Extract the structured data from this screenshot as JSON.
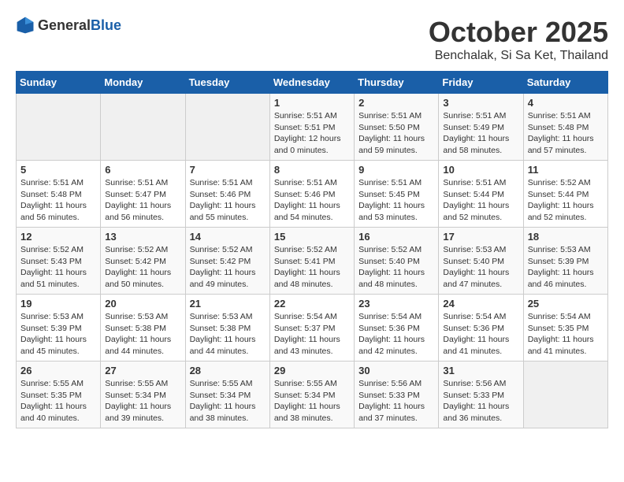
{
  "header": {
    "logo_general": "General",
    "logo_blue": "Blue",
    "month": "October 2025",
    "location": "Benchalak, Si Sa Ket, Thailand"
  },
  "days_of_week": [
    "Sunday",
    "Monday",
    "Tuesday",
    "Wednesday",
    "Thursday",
    "Friday",
    "Saturday"
  ],
  "weeks": [
    [
      {
        "day": "",
        "info": ""
      },
      {
        "day": "",
        "info": ""
      },
      {
        "day": "",
        "info": ""
      },
      {
        "day": "1",
        "info": "Sunrise: 5:51 AM\nSunset: 5:51 PM\nDaylight: 12 hours\nand 0 minutes."
      },
      {
        "day": "2",
        "info": "Sunrise: 5:51 AM\nSunset: 5:50 PM\nDaylight: 11 hours\nand 59 minutes."
      },
      {
        "day": "3",
        "info": "Sunrise: 5:51 AM\nSunset: 5:49 PM\nDaylight: 11 hours\nand 58 minutes."
      },
      {
        "day": "4",
        "info": "Sunrise: 5:51 AM\nSunset: 5:48 PM\nDaylight: 11 hours\nand 57 minutes."
      }
    ],
    [
      {
        "day": "5",
        "info": "Sunrise: 5:51 AM\nSunset: 5:48 PM\nDaylight: 11 hours\nand 56 minutes."
      },
      {
        "day": "6",
        "info": "Sunrise: 5:51 AM\nSunset: 5:47 PM\nDaylight: 11 hours\nand 56 minutes."
      },
      {
        "day": "7",
        "info": "Sunrise: 5:51 AM\nSunset: 5:46 PM\nDaylight: 11 hours\nand 55 minutes."
      },
      {
        "day": "8",
        "info": "Sunrise: 5:51 AM\nSunset: 5:46 PM\nDaylight: 11 hours\nand 54 minutes."
      },
      {
        "day": "9",
        "info": "Sunrise: 5:51 AM\nSunset: 5:45 PM\nDaylight: 11 hours\nand 53 minutes."
      },
      {
        "day": "10",
        "info": "Sunrise: 5:51 AM\nSunset: 5:44 PM\nDaylight: 11 hours\nand 52 minutes."
      },
      {
        "day": "11",
        "info": "Sunrise: 5:52 AM\nSunset: 5:44 PM\nDaylight: 11 hours\nand 52 minutes."
      }
    ],
    [
      {
        "day": "12",
        "info": "Sunrise: 5:52 AM\nSunset: 5:43 PM\nDaylight: 11 hours\nand 51 minutes."
      },
      {
        "day": "13",
        "info": "Sunrise: 5:52 AM\nSunset: 5:42 PM\nDaylight: 11 hours\nand 50 minutes."
      },
      {
        "day": "14",
        "info": "Sunrise: 5:52 AM\nSunset: 5:42 PM\nDaylight: 11 hours\nand 49 minutes."
      },
      {
        "day": "15",
        "info": "Sunrise: 5:52 AM\nSunset: 5:41 PM\nDaylight: 11 hours\nand 48 minutes."
      },
      {
        "day": "16",
        "info": "Sunrise: 5:52 AM\nSunset: 5:40 PM\nDaylight: 11 hours\nand 48 minutes."
      },
      {
        "day": "17",
        "info": "Sunrise: 5:53 AM\nSunset: 5:40 PM\nDaylight: 11 hours\nand 47 minutes."
      },
      {
        "day": "18",
        "info": "Sunrise: 5:53 AM\nSunset: 5:39 PM\nDaylight: 11 hours\nand 46 minutes."
      }
    ],
    [
      {
        "day": "19",
        "info": "Sunrise: 5:53 AM\nSunset: 5:39 PM\nDaylight: 11 hours\nand 45 minutes."
      },
      {
        "day": "20",
        "info": "Sunrise: 5:53 AM\nSunset: 5:38 PM\nDaylight: 11 hours\nand 44 minutes."
      },
      {
        "day": "21",
        "info": "Sunrise: 5:53 AM\nSunset: 5:38 PM\nDaylight: 11 hours\nand 44 minutes."
      },
      {
        "day": "22",
        "info": "Sunrise: 5:54 AM\nSunset: 5:37 PM\nDaylight: 11 hours\nand 43 minutes."
      },
      {
        "day": "23",
        "info": "Sunrise: 5:54 AM\nSunset: 5:36 PM\nDaylight: 11 hours\nand 42 minutes."
      },
      {
        "day": "24",
        "info": "Sunrise: 5:54 AM\nSunset: 5:36 PM\nDaylight: 11 hours\nand 41 minutes."
      },
      {
        "day": "25",
        "info": "Sunrise: 5:54 AM\nSunset: 5:35 PM\nDaylight: 11 hours\nand 41 minutes."
      }
    ],
    [
      {
        "day": "26",
        "info": "Sunrise: 5:55 AM\nSunset: 5:35 PM\nDaylight: 11 hours\nand 40 minutes."
      },
      {
        "day": "27",
        "info": "Sunrise: 5:55 AM\nSunset: 5:34 PM\nDaylight: 11 hours\nand 39 minutes."
      },
      {
        "day": "28",
        "info": "Sunrise: 5:55 AM\nSunset: 5:34 PM\nDaylight: 11 hours\nand 38 minutes."
      },
      {
        "day": "29",
        "info": "Sunrise: 5:55 AM\nSunset: 5:34 PM\nDaylight: 11 hours\nand 38 minutes."
      },
      {
        "day": "30",
        "info": "Sunrise: 5:56 AM\nSunset: 5:33 PM\nDaylight: 11 hours\nand 37 minutes."
      },
      {
        "day": "31",
        "info": "Sunrise: 5:56 AM\nSunset: 5:33 PM\nDaylight: 11 hours\nand 36 minutes."
      },
      {
        "day": "",
        "info": ""
      }
    ]
  ]
}
